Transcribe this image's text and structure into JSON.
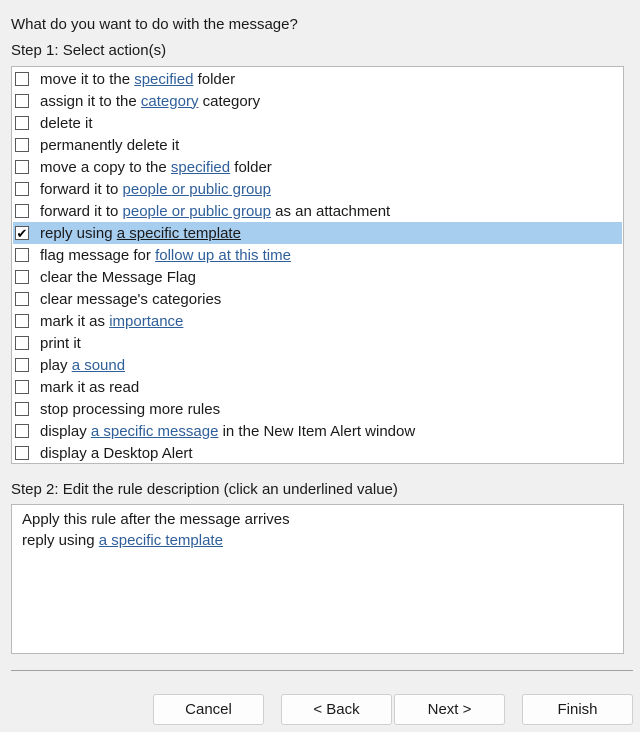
{
  "header": {
    "question": "What do you want to do with the message?",
    "step1_label": "Step 1: Select action(s)"
  },
  "actions": [
    {
      "checked": false,
      "pre": "move it to the ",
      "link": "specified",
      "post": " folder"
    },
    {
      "checked": false,
      "pre": "assign it to the ",
      "link": "category",
      "post": " category"
    },
    {
      "checked": false,
      "pre": "delete it",
      "link": "",
      "post": ""
    },
    {
      "checked": false,
      "pre": "permanently delete it",
      "link": "",
      "post": ""
    },
    {
      "checked": false,
      "pre": "move a copy to the ",
      "link": "specified",
      "post": " folder"
    },
    {
      "checked": false,
      "pre": "forward it to ",
      "link": "people or public group",
      "post": ""
    },
    {
      "checked": false,
      "pre": "forward it to ",
      "link": "people or public group",
      "post": " as an attachment"
    },
    {
      "checked": true,
      "pre": "reply using ",
      "link": "a specific template",
      "post": ""
    },
    {
      "checked": false,
      "pre": "flag message for ",
      "link": "follow up at this time",
      "post": ""
    },
    {
      "checked": false,
      "pre": "clear the Message Flag",
      "link": "",
      "post": ""
    },
    {
      "checked": false,
      "pre": "clear message's categories",
      "link": "",
      "post": ""
    },
    {
      "checked": false,
      "pre": "mark it as ",
      "link": "importance",
      "post": ""
    },
    {
      "checked": false,
      "pre": "print it",
      "link": "",
      "post": ""
    },
    {
      "checked": false,
      "pre": "play ",
      "link": "a sound",
      "post": ""
    },
    {
      "checked": false,
      "pre": "mark it as read",
      "link": "",
      "post": ""
    },
    {
      "checked": false,
      "pre": "stop processing more rules",
      "link": "",
      "post": ""
    },
    {
      "checked": false,
      "pre": "display ",
      "link": "a specific message",
      "post": " in the New Item Alert window"
    },
    {
      "checked": false,
      "pre": "display a Desktop Alert",
      "link": "",
      "post": ""
    }
  ],
  "step2": {
    "label": "Step 2: Edit the rule description (click an underlined value)",
    "line1": "Apply this rule after the message arrives",
    "line2_pre": "reply using ",
    "line2_link": "a specific template"
  },
  "buttons": {
    "cancel": "Cancel",
    "back": "< Back",
    "next": "Next >",
    "finish": "Finish"
  },
  "colors": {
    "selection": "#a7cdef",
    "link": "#2f5f9a"
  }
}
